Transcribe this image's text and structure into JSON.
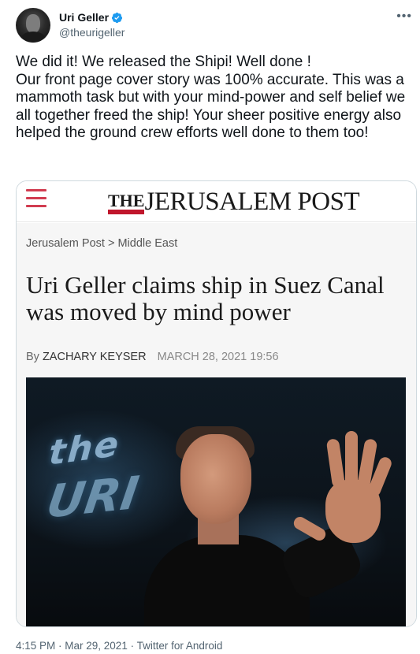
{
  "author": {
    "name": "Uri Geller",
    "handle": "@theurigeller",
    "verified": true,
    "avatar_icon": "avatar"
  },
  "menu_icon": "more-icon",
  "tweet": {
    "text": "We did it! We released the Shipi! Well done !\nOur front page cover story was 100% accurate. This was a mammoth task but with your mind-power and self belief we all together freed the ship! Your sheer positive energy also helped the ground crew efforts well done to them too!",
    "meta": "4:15 PM · Mar 29, 2021 · Twitter for Android"
  },
  "card": {
    "logo_the": "THE",
    "logo_main": "JERUSALEM POST",
    "breadcrumb_home": "Jerusalem Post",
    "breadcrumb_sep": ">",
    "breadcrumb_section": "Middle East",
    "headline": "Uri Geller claims ship in Suez Canal was moved by mind power",
    "by_label": "By",
    "author": "ZACHARY KEYSER",
    "date": "MARCH 28, 2021 19:56",
    "photo_text_1": "the",
    "photo_text_2": "URI"
  },
  "colors": {
    "accent_red": "#c0162c",
    "verified_blue": "#1d9bf0",
    "muted": "#536471"
  }
}
